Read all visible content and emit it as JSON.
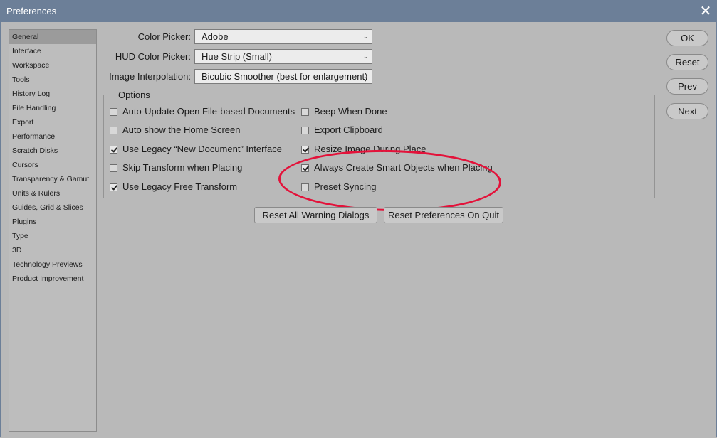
{
  "window": {
    "title": "Preferences",
    "close_glyph": "✕"
  },
  "sidebar": {
    "items": [
      {
        "label": "General",
        "selected": true
      },
      {
        "label": "Interface"
      },
      {
        "label": "Workspace"
      },
      {
        "label": "Tools"
      },
      {
        "label": "History Log"
      },
      {
        "label": "File Handling"
      },
      {
        "label": "Export"
      },
      {
        "label": "Performance"
      },
      {
        "label": "Scratch Disks"
      },
      {
        "label": "Cursors"
      },
      {
        "label": "Transparency & Gamut"
      },
      {
        "label": "Units & Rulers"
      },
      {
        "label": "Guides, Grid & Slices"
      },
      {
        "label": "Plugins"
      },
      {
        "label": "Type"
      },
      {
        "label": "3D"
      },
      {
        "label": "Technology Previews"
      },
      {
        "label": "Product Improvement"
      }
    ]
  },
  "general": {
    "color_picker": {
      "label": "Color Picker:",
      "value": "Adobe"
    },
    "hud_color_picker": {
      "label": "HUD Color Picker:",
      "value": "Hue Strip (Small)"
    },
    "image_interpolation": {
      "label": "Image Interpolation:",
      "value": "Bicubic Smoother (best for enlargement)"
    },
    "options_title": "Options",
    "options": [
      {
        "label": "Auto-Update Open File-based Documents",
        "checked": false
      },
      {
        "label": "Auto show the Home Screen",
        "checked": false
      },
      {
        "label": "Use Legacy “New Document” Interface",
        "checked": true
      },
      {
        "label": "Skip Transform when Placing",
        "checked": false
      },
      {
        "label": "Use Legacy Free Transform",
        "checked": true
      },
      {
        "label": "Beep When Done",
        "checked": false
      },
      {
        "label": "Export Clipboard",
        "checked": false
      },
      {
        "label": "Resize Image During Place",
        "checked": true
      },
      {
        "label": "Always Create Smart Objects when Placing",
        "checked": true
      },
      {
        "label": "Preset Syncing",
        "checked": false
      }
    ],
    "reset_warnings_label": "Reset All Warning Dialogs",
    "reset_prefs_label": "Reset Preferences On Quit"
  },
  "actions": {
    "ok": "OK",
    "reset": "Reset",
    "prev": "Prev",
    "next": "Next"
  },
  "annotation": {
    "color": "#e3123a"
  },
  "colors": {
    "titlebar": "#6c7f98",
    "background": "#b9b9b9"
  }
}
